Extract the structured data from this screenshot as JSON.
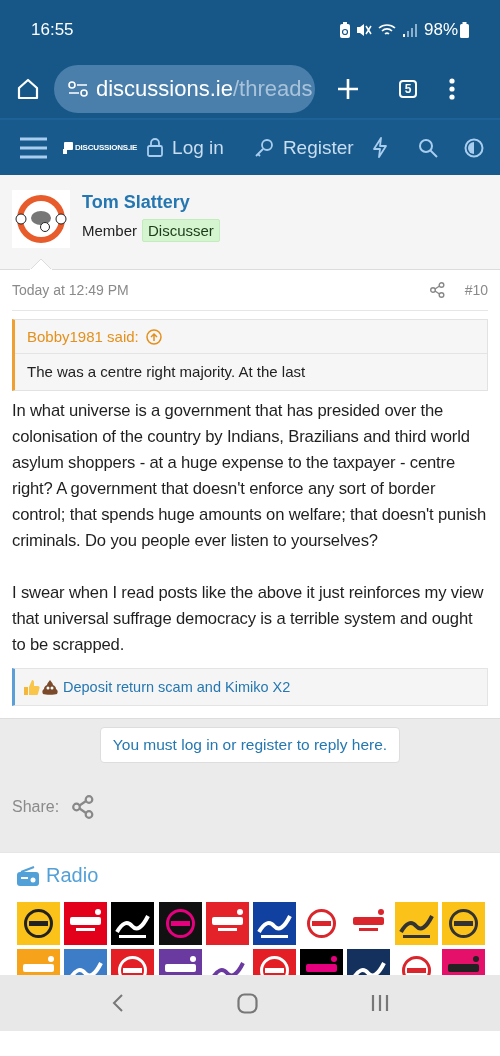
{
  "status_bar": {
    "time": "16:55",
    "battery": "98%"
  },
  "browser": {
    "url_host": "discussions.ie",
    "url_path": "/threads",
    "tab_count": "5"
  },
  "site_nav": {
    "logo": "DISCUSSIONS.IE",
    "login": "Log in",
    "register": "Register"
  },
  "post": {
    "author": "Tom Slattery",
    "role": "Member",
    "banner": "Discusser",
    "time": "Today at 12:49 PM",
    "number": "#10",
    "quote": {
      "author": "Bobby1981 said:",
      "text": "The was a centre right majority. At the last"
    },
    "paragraphs": [
      "In what universe is a government that has presided over the colonisation of the country by Indians, Brazilians and third world asylum shoppers - at a huge expense to the taxpayer - centre right? A government that doesn't enforce any sort of border control; that spends huge amounts on welfare; that doesn't punish criminals. Do you people ever listen to yourselves?",
      "I swear when I read posts like the above it just reinforces my view that universal suffrage democracy is a terrible system and ought to be scrapped."
    ],
    "reactions": "Deposit return scam and Kimiko X2"
  },
  "reply_notice": "You must log in or register to reply here.",
  "share_label": "Share:",
  "radio": {
    "title": "Radio"
  }
}
